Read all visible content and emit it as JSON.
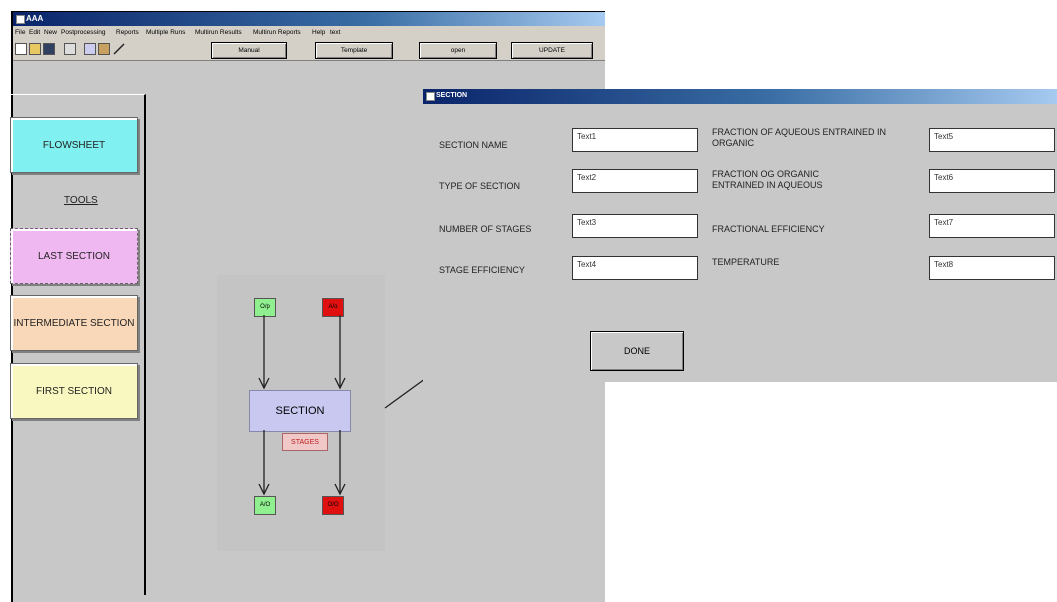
{
  "main_window": {
    "title": "AAA",
    "menu": [
      "File",
      "Edit",
      "New",
      "Postprocessing",
      "Reports",
      "Multiple Runs",
      "Multirun Results",
      "Multirun Reports",
      "Help",
      "text"
    ],
    "toolbar_buttons": [
      "Manual",
      "Template",
      "open",
      "UPDATE"
    ],
    "toolbar_icons": [
      "new-file-icon",
      "open-folder-icon",
      "save-icon",
      "print-icon",
      "copy-icon",
      "paste-icon",
      "pencil-icon"
    ]
  },
  "sidebar": {
    "flowsheet": "FLOWSHEET",
    "tools": "TOOLS",
    "last_section": "LAST SECTION",
    "intermediate_section": "INTERMEDIATE SECTION",
    "first_section": "FIRST SECTION",
    "colors": {
      "flowsheet": "#80f0f0",
      "last": "#f0b8f0",
      "intermediate": "#f8d8b8",
      "first": "#f8f8c0"
    }
  },
  "diagram": {
    "node_top_left": "O/p",
    "node_top_right": "A/o",
    "section": "SECTION",
    "stages": "STAGES",
    "node_bottom_left": "A/O",
    "node_bottom_right": "O/O",
    "colors": {
      "green": "#90f090",
      "red": "#e01010"
    }
  },
  "dialog": {
    "title": "SECTION",
    "fields_left": [
      {
        "label": "SECTION NAME",
        "value": "Text1"
      },
      {
        "label": "TYPE OF SECTION",
        "value": "Text2"
      },
      {
        "label": "NUMBER OF STAGES",
        "value": "Text3"
      },
      {
        "label": "STAGE EFFICIENCY",
        "value": "Text4"
      }
    ],
    "fields_right": [
      {
        "label": "FRACTION OF AQUEOUS ENTRAINED IN ORGANIC",
        "value": "Text5"
      },
      {
        "label": "FRACTION OG ORGANIC ENTRAINED IN AQUEOUS",
        "value": "Text6"
      },
      {
        "label": "FRACTIONAL EFFICIENCY",
        "value": "Text7"
      },
      {
        "label": "TEMPERATURE",
        "value": "Text8"
      }
    ],
    "done": "DONE"
  }
}
